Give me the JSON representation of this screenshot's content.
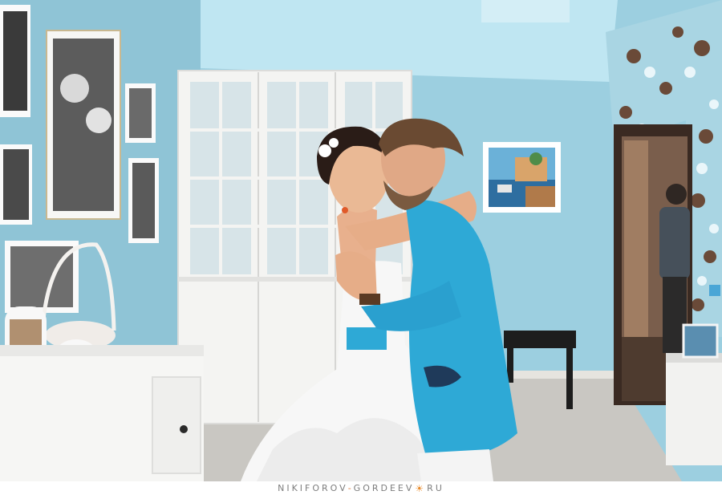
{
  "photo": {
    "subject": "wedding-couple-embrace",
    "palette": {
      "wall": "#9ccfe0",
      "ceiling": "#bfe6f2",
      "floor": "#c9c7c2",
      "wardrobe": "#f4f4f2",
      "jacket": "#2ea9d6",
      "dress": "#f7f7f7",
      "wallpaper_accent": "#6a4a38"
    }
  },
  "watermark": {
    "part1": "NIKIFOROV",
    "dash": "-",
    "part2": "GORDEEV",
    "sun": "☀",
    "part3": "RU"
  }
}
